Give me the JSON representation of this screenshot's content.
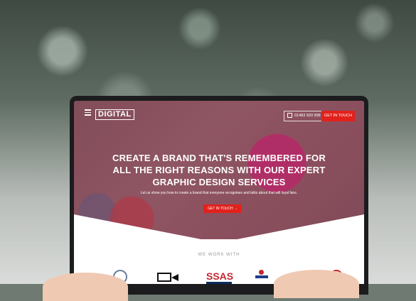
{
  "nav": {
    "logo_text": "DIGITAL",
    "phone": "01483 920 998",
    "cta_label": "GET IN TOUCH"
  },
  "hero": {
    "headline_line1": "CREATE A BRAND THAT'S REMEMBERED FOR",
    "headline_line2": "ALL THE RIGHT REASONS WITH OUR EXPERT",
    "headline_line3": "GRAPHIC DESIGN SERVICES",
    "subtext": "Let us show you how to create a brand that everyone recognises and talks about that will loyal fans.",
    "cta_label": "GET IN TOUCH →"
  },
  "clients": {
    "label": "WE WORK WITH",
    "items": [
      {
        "name": "circle-logo-icon"
      },
      {
        "name": "video-camera-icon"
      },
      {
        "name": "SSAS"
      },
      {
        "name": "person-logo-icon"
      },
      {
        "name": "red-circle-logo-icon"
      }
    ]
  },
  "colors": {
    "accent": "#e2211c",
    "hero_overlay": "#7a2a3c"
  }
}
